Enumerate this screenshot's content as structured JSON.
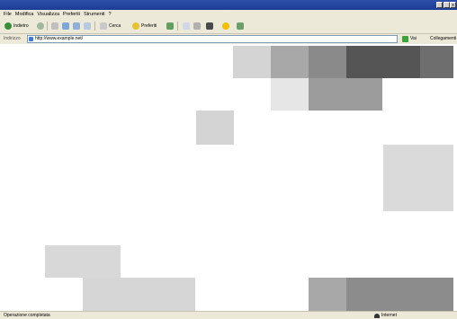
{
  "window": {
    "title": "",
    "controls": [
      "",
      "",
      "x"
    ]
  },
  "menu": [
    "File",
    "Modifica",
    "Visualizza",
    "Preferiti",
    "Strumenti",
    "?"
  ],
  "toolbar": {
    "back_label": "Indietro",
    "search_label": "Cerca",
    "favorites_label": "Preferiti"
  },
  "address": {
    "label": "Indirizzo",
    "value": "http://www.example.net/",
    "go_label": "Vai",
    "links_label": "Collegamenti"
  },
  "status": {
    "left": "Operazione completata",
    "zone": "Internet"
  },
  "colors": {
    "titlebar": "#1c3c96",
    "chrome": "#ece9d8",
    "content": "#ffffff",
    "tiles": [
      "#d4d4d4",
      "#a8a8a8",
      "#8a8a8a",
      "#555555",
      "#6e6e6e",
      "#e6e6e6",
      "#9c9c9c",
      "#dadada",
      "#d8d8d8"
    ]
  },
  "icons": [
    "back-icon",
    "forward-icon",
    "stop-icon",
    "refresh-icon",
    "home-icon",
    "search-icon",
    "favorites-icon",
    "history-icon",
    "mail-icon",
    "print-icon",
    "edit-icon",
    "messenger-icon",
    "go-icon",
    "internet-zone-icon",
    "page-icon"
  ]
}
